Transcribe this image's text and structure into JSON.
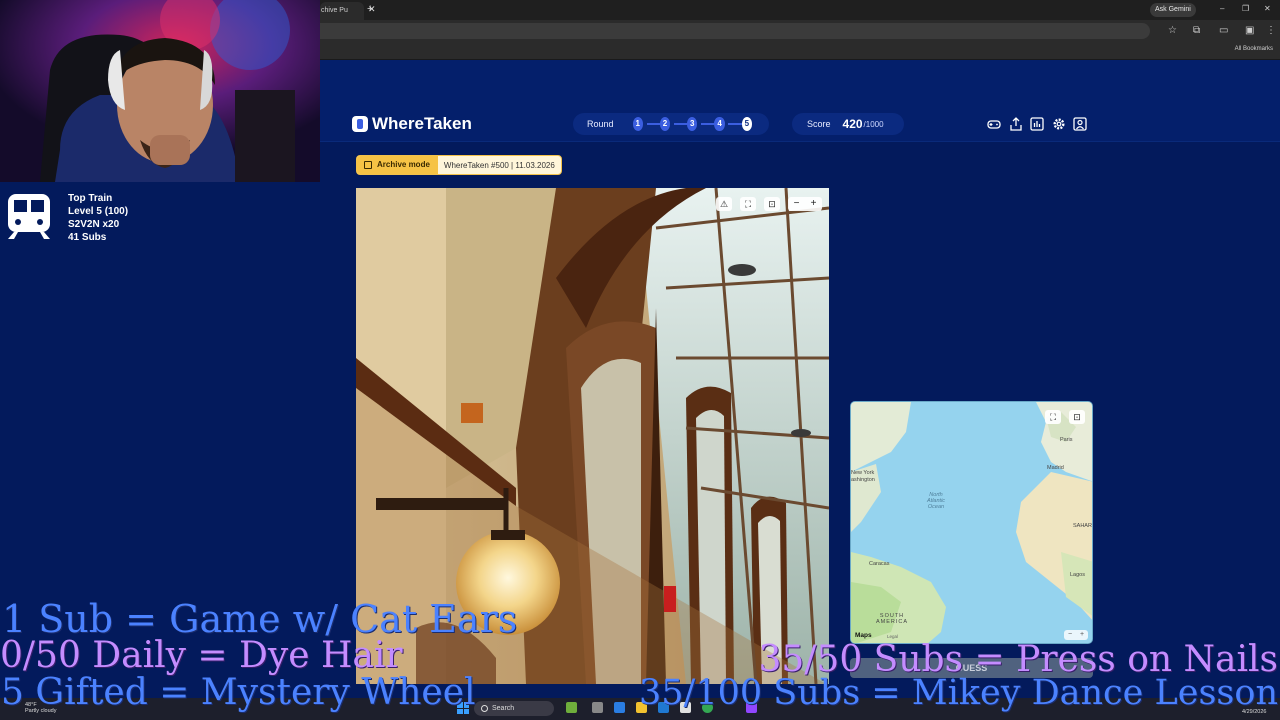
{
  "browser": {
    "tab_title": "chive Pu",
    "tab_close": "✕",
    "new_tab": "+",
    "ask_gemini": "Ask Gemini",
    "window_controls": [
      "–",
      "❐",
      "✕"
    ],
    "all_bookmarks": "All Bookmarks"
  },
  "header": {
    "brand": "WhereTaken",
    "round_label": "Round",
    "rounds": [
      "1",
      "2",
      "3",
      "4",
      "5"
    ],
    "current_round": 5,
    "score_label": "Score",
    "score_value": "420",
    "score_max": "/1000",
    "icons": [
      "gamepad-icon",
      "share-icon",
      "stats-icon",
      "settings-icon",
      "profile-icon"
    ]
  },
  "archive": {
    "tag": "Archive mode",
    "info": "WhereTaken #500 | 11.03.2026"
  },
  "photo": {
    "tools": [
      "⚠",
      "⛶",
      "⊡"
    ],
    "zoom_out": "−",
    "zoom_in": "+"
  },
  "map": {
    "labels": {
      "new_york": "New York",
      "washington": "ashington",
      "ocean": "North\nAtlantic\nOcean",
      "paris": "Paris",
      "madrid": "Madrid",
      "sahara": "SAHAR",
      "caracas": "Caracas",
      "south_america": "SOUTH\nAMERICA",
      "lagos": "Lagos"
    },
    "attribution": "Maps",
    "legal": "Legal",
    "zoom_out": "−",
    "zoom_in": "+",
    "guess_button": "GUESS"
  },
  "train_widget": {
    "title": "Top Train",
    "level": "Level 5  (100)",
    "user": "S2V2N x20",
    "subs": "41 Subs"
  },
  "overlay_goals": [
    "1 Sub = Game w/ Cat Ears",
    "0/50 Daily = Dye Hair",
    "5 Gifted = Mystery Wheel",
    "35/50 Subs = Press on Nails",
    "35/100 Subs = Mikey Dance Lesson"
  ],
  "taskbar": {
    "weather_temp": "48°F",
    "weather_desc": "Partly cloudy",
    "search": "Search",
    "date": "4/29/2026"
  },
  "colors": {
    "page_bg": "#031a5c",
    "accent": "#3b5ee0",
    "archive_tag": "#f6c345",
    "goal_blue": "#4b82ff",
    "goal_purple": "#c48cff"
  }
}
